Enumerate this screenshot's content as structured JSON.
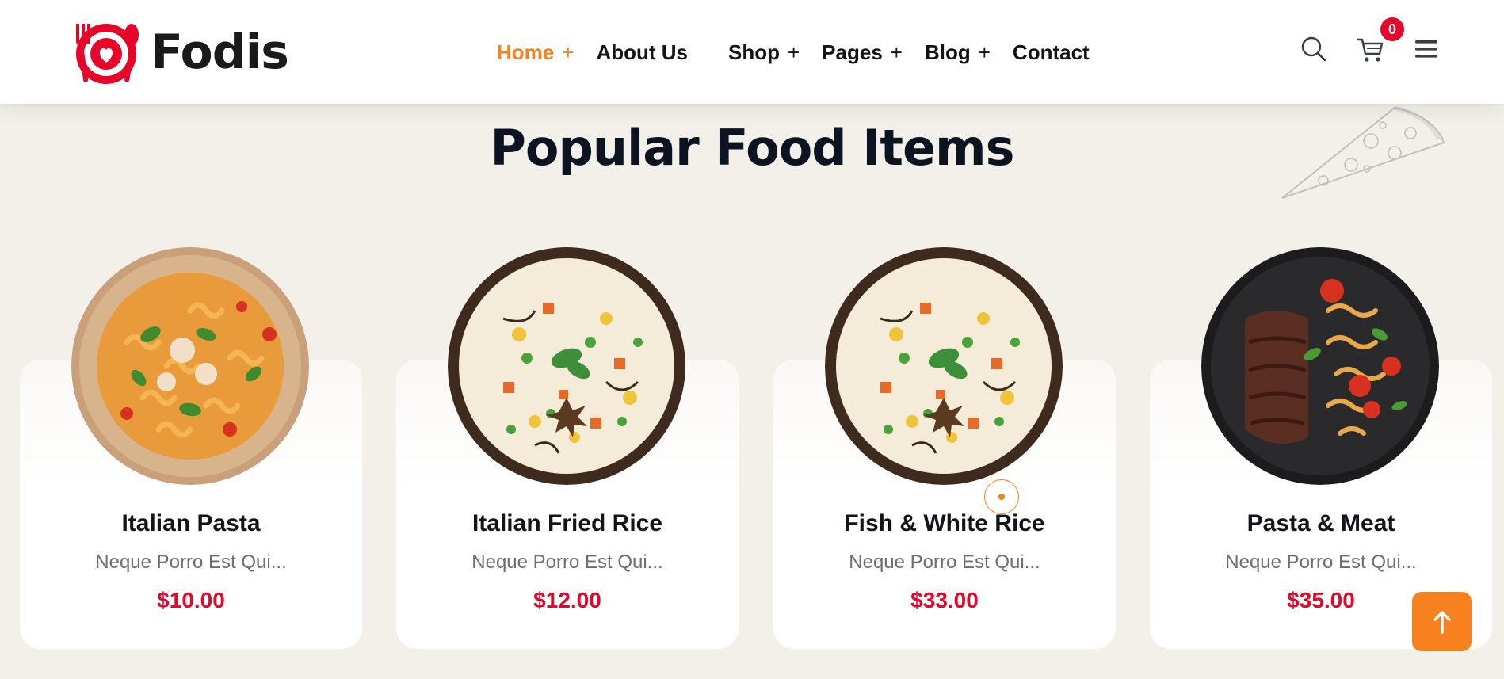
{
  "brand": {
    "name": "Fodis",
    "accent": "#f7811e",
    "price_color": "#e5062a"
  },
  "nav": {
    "items": [
      {
        "label": "Home",
        "has_submenu": true,
        "active": true
      },
      {
        "label": "About Us",
        "has_submenu": false
      },
      {
        "label": "Shop",
        "has_submenu": true
      },
      {
        "label": "Pages",
        "has_submenu": true
      },
      {
        "label": "Blog",
        "has_submenu": true
      },
      {
        "label": "Contact",
        "has_submenu": false
      }
    ],
    "submenu_indicator": "+"
  },
  "header_icons": {
    "search": "search-icon",
    "cart": "cart-icon",
    "menu": "hamburger-icon",
    "cart_count": "0"
  },
  "section": {
    "title": "Popular Food Items"
  },
  "products": [
    {
      "name": "Italian Pasta",
      "description": "Neque Porro Est Qui...",
      "price": "$10.00",
      "image": "pasta-dish"
    },
    {
      "name": "Italian Fried Rice",
      "description": "Neque Porro Est Qui...",
      "price": "$12.00",
      "image": "fried-rice-dish"
    },
    {
      "name": "Fish & White Rice",
      "description": "Neque Porro Est Qui...",
      "price": "$33.00",
      "image": "fried-rice-dish"
    },
    {
      "name": "Pasta & Meat",
      "description": "Neque Porro Est Qui...",
      "price": "$35.00",
      "image": "steak-pasta-dish"
    }
  ],
  "scroll_top_icon": "arrow-up-icon"
}
